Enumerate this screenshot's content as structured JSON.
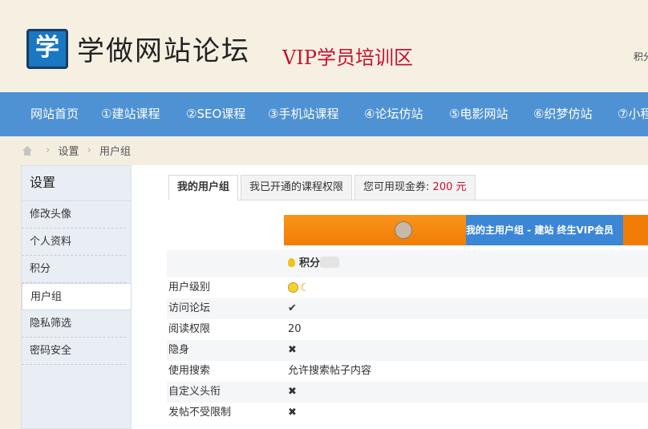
{
  "header": {
    "logo_char": "学",
    "title": "学做网站论坛",
    "subtitle": "VIP学员培训区",
    "right_text": "积分"
  },
  "nav": {
    "items": [
      "网站首页",
      "①建站课程",
      "②SEO课程",
      "③手机站课程",
      "④论坛仿站",
      "⑤电影网站",
      "⑥织梦仿站",
      "⑦小程"
    ]
  },
  "breadcrumb": {
    "items": [
      "设置",
      "用户组"
    ]
  },
  "sidebar": {
    "title": "设置",
    "items": [
      "修改头像",
      "个人资料",
      "积分",
      "用户组",
      "隐私筛选",
      "密码安全"
    ],
    "active_index": 3
  },
  "tabs": {
    "my_group": "我的用户组",
    "course_rights": "我已开通的课程权限",
    "cash_label": "您可用现金券: ",
    "cash_value": "200 元"
  },
  "group_bar": {
    "text": "我的主用户组 - 建站 终生VIP会员"
  },
  "permissions": {
    "points_label": "积分",
    "rows": [
      {
        "label": "用户级别",
        "value": "",
        "icon": "smiley-moon-icon"
      },
      {
        "label": "访问论坛",
        "value": "✔",
        "icon": "check-icon"
      },
      {
        "label": "阅读权限",
        "value": "20",
        "icon": ""
      },
      {
        "label": "隐身",
        "value": "✖",
        "icon": "cross-icon"
      },
      {
        "label": "使用搜索",
        "value": "允许搜索帖子内容",
        "icon": ""
      },
      {
        "label": "自定义头衔",
        "value": "✖",
        "icon": "cross-icon"
      },
      {
        "label": "发帖不受限制",
        "value": "✖",
        "icon": "cross-icon"
      }
    ]
  },
  "colors": {
    "nav_bg": "#4f92d4",
    "accent_red": "#c8102e",
    "group_orange": "#f07d06",
    "group_blue": "#3c86d6"
  }
}
